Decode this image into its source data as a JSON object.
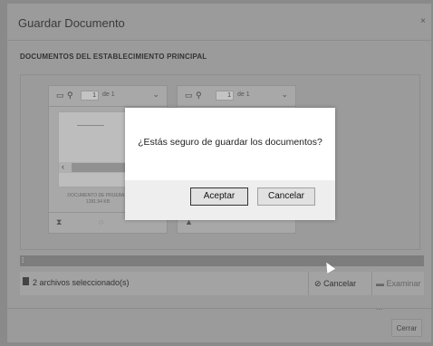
{
  "dialog": {
    "title": "Guardar Documento",
    "close_glyph": "×",
    "section_title": "DOCUMENTOS DEL ESTABLECIMIENTO PRINCIPAL",
    "close_button": "Cerrar"
  },
  "viewers": [
    {
      "page": "1",
      "of_label": "de 1",
      "caption": "DOCUMENTO DE PRUEBA...\n1281.94 KB"
    },
    {
      "page": "1",
      "of_label": "de 1"
    }
  ],
  "upload": {
    "files_label": "2 archivos seleccionado(s)",
    "cancel_label": "Cancelar",
    "browse_label": "Examinar ..."
  },
  "confirm": {
    "message": "¿Estás seguro de guardar los documentos?",
    "accept_label": "Aceptar",
    "cancel_label": "Cancelar"
  },
  "icons": [
    "sidebar-toggle-icon",
    "search-icon",
    "chevron-down-icon",
    "hourglass-icon",
    "file-icon",
    "ban-icon",
    "folder-open-icon",
    "mouse-cursor-icon"
  ]
}
